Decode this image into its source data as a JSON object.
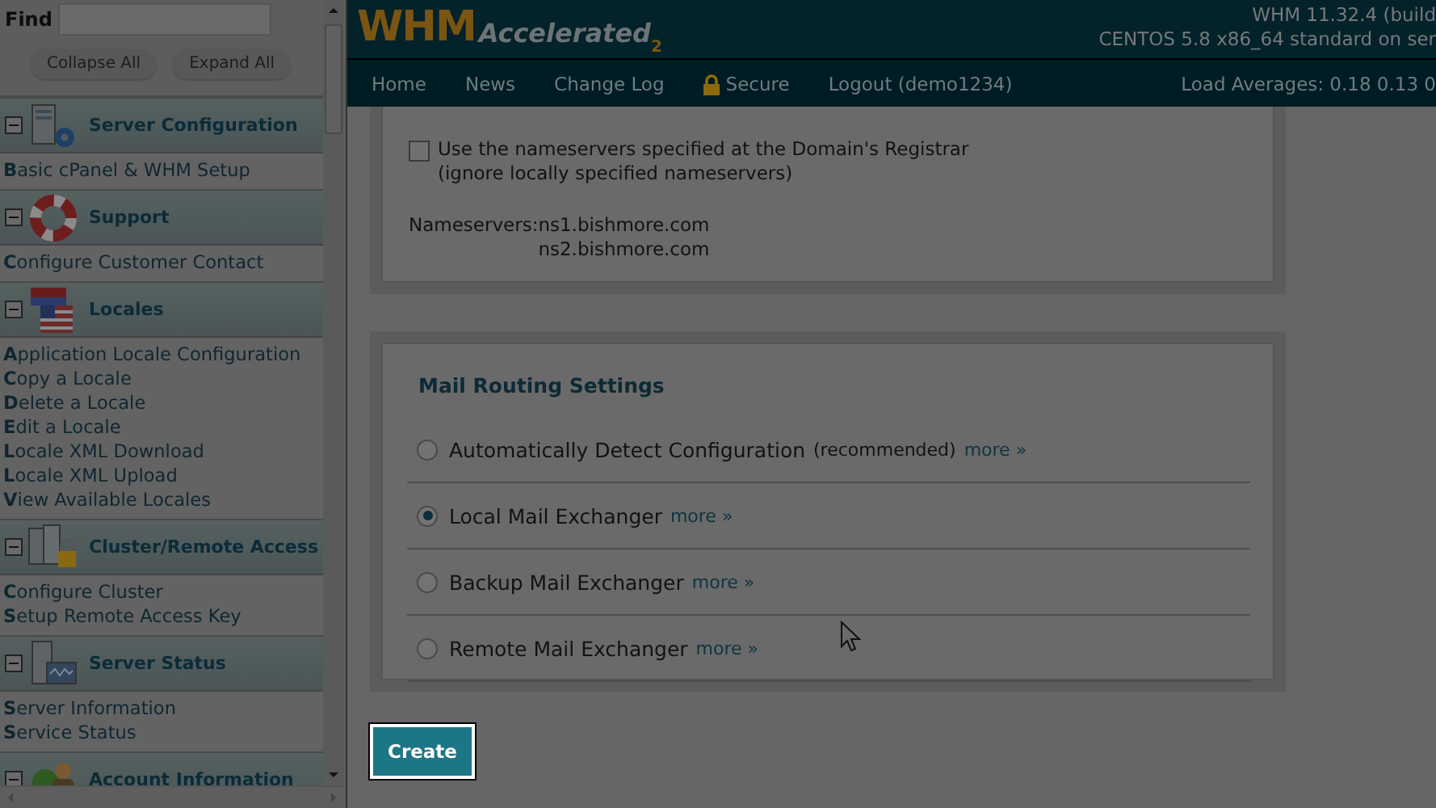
{
  "sidebar": {
    "find_label": "Find",
    "buttons": [
      "Collapse All",
      "Expand All"
    ],
    "sections": [
      {
        "title": "Server Configuration",
        "expanded": true,
        "items": [
          "**B**asic cPanel & WHM Setup"
        ]
      },
      {
        "title": "Support",
        "expanded": true,
        "items": [
          "**C**onfigure Customer Contact"
        ]
      },
      {
        "title": "Locales",
        "expanded": true,
        "items": [
          "**A**pplication Locale Configuration",
          "**C**opy a Locale",
          "**D**elete a Locale",
          "**E**dit a Locale",
          "**L**ocale XML Download",
          "**L**ocale XML Upload",
          "**V**iew Available Locales"
        ]
      },
      {
        "title": "Cluster/Remote Access",
        "expanded": true,
        "items": [
          "**C**onfigure Cluster",
          "**S**etup Remote Access Key"
        ]
      },
      {
        "title": "Server Status",
        "expanded": true,
        "items": [
          "**S**erver Information",
          "**S**ervice Status"
        ]
      },
      {
        "title": "Account Information",
        "expanded": true
      }
    ]
  },
  "header": {
    "logo": {
      "main": "WHM",
      "sub": "Accelerated",
      "version": "2"
    },
    "build": "WHM 11.32.4 (build",
    "system": "CENTOS 5.8 x86_64 standard on ser",
    "nav": [
      {
        "label": "Home",
        "kind": "link"
      },
      {
        "label": "News",
        "kind": "link"
      },
      {
        "label": "Change Log",
        "kind": "link"
      },
      {
        "label": "Secure",
        "kind": "secure"
      },
      {
        "label": "Logout (demo1234)",
        "kind": "link"
      }
    ],
    "load": "Load Averages: 0.18 0.13 0"
  },
  "nameserver_panel": {
    "checkbox": {
      "label": "Use the nameservers specified at the Domain's Registrar",
      "note": "(ignore locally specified nameservers)",
      "checked": false
    },
    "nameservers_label": "Nameservers:",
    "nameservers": [
      "ns1.bishmore.com",
      "ns2.bishmore.com"
    ]
  },
  "mail_routing": {
    "title": "Mail Routing Settings",
    "options": [
      {
        "label": "Automatically Detect Configuration",
        "note": "(recommended)",
        "more": "more »",
        "selected": false
      },
      {
        "label": "Local Mail Exchanger",
        "more": "more »",
        "selected": true
      },
      {
        "label": "Backup Mail Exchanger",
        "more": "more »",
        "selected": false
      },
      {
        "label": "Remote Mail Exchanger",
        "more": "more »",
        "selected": false
      }
    ]
  },
  "create_button": "Create"
}
